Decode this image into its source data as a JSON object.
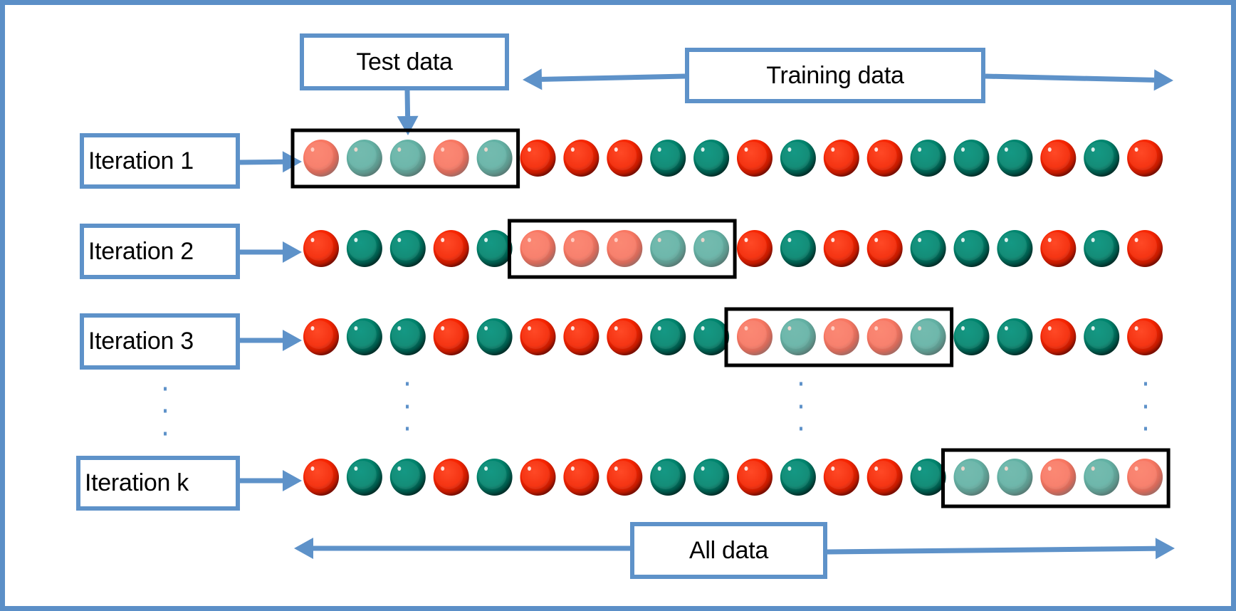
{
  "diagram": {
    "title_labels": {
      "test_data": "Test data",
      "training_data": "Training data",
      "all_data": "All data"
    },
    "iterations": [
      {
        "label": "Iteration 1",
        "test_fold": 0
      },
      {
        "label": "Iteration 2",
        "test_fold": 1
      },
      {
        "label": "Iteration 3",
        "test_fold": 2
      },
      {
        "label": "Iteration k",
        "test_fold": 3
      }
    ],
    "samples": [
      "red",
      "green",
      "green",
      "red",
      "green",
      "red",
      "red",
      "red",
      "green",
      "green",
      "red",
      "green",
      "red",
      "red",
      "green",
      "green",
      "green",
      "red",
      "green",
      "red"
    ],
    "fold_size": 5,
    "ellipsis": "...",
    "colors": {
      "accent_blue": "#5e92c9",
      "red": "#ff2600",
      "red_test": "#f97964",
      "green": "#00856f",
      "green_test": "#62b2a5",
      "test_box": "#000000"
    }
  }
}
